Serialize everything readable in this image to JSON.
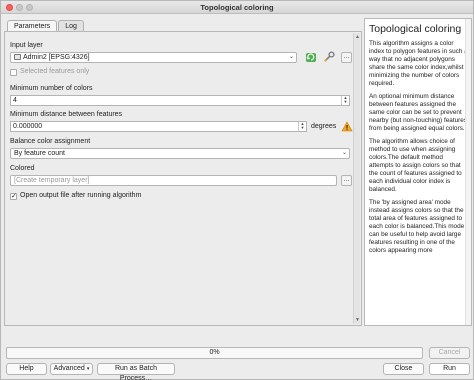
{
  "window": {
    "title": "Topological coloring"
  },
  "tabs": [
    {
      "label": "Parameters"
    },
    {
      "label": "Log"
    }
  ],
  "params": {
    "input_layer_label": "Input layer",
    "input_layer_value": "Admin2 [EPSG:4326]",
    "selected_only_label": "Selected features only",
    "min_colors_label": "Minimum number of colors",
    "min_colors_value": "4",
    "min_distance_label": "Minimum distance between features",
    "min_distance_value": "0.000000",
    "min_distance_unit": "degrees",
    "balance_label": "Balance color assignment",
    "balance_value": "By feature count",
    "colored_label": "Colored",
    "colored_placeholder": "[Create temporary layer]",
    "open_output_label": "Open output file after running algorithm",
    "open_output_checked": true,
    "selected_only_checked": false,
    "browse_label": "…"
  },
  "help": {
    "title": "Topological coloring",
    "paragraphs": [
      "This algorithm assigns a color index to polygon features in such a way that no adjacent polygons share the same color index,whilst minimizing the number of colors required.",
      "An optional minimum distance between features assigned the same color can be set to prevent nearby (but non-touching) features from being assigned equal colors.",
      "The algorithm allows choice of method to use when assigning colors.The default method attempts to assign colors so that the count of features assigned to each individual color index is balanced.",
      "The 'by assigned area' mode instead assigns colors so that the total area of features assigned to each color is balanced.This mode can be useful to help avoid large features resulting in one of the colors appearing more"
    ]
  },
  "progress": {
    "text": "0%",
    "value": 0
  },
  "buttons": {
    "cancel": "Cancel",
    "help": "Help",
    "advanced": "Advanced",
    "batch": "Run as Batch Process…",
    "close": "Close",
    "run": "Run"
  },
  "colors": {
    "accent": "#3478f6",
    "warning": "#f5a623",
    "reload": "#4caf50"
  }
}
